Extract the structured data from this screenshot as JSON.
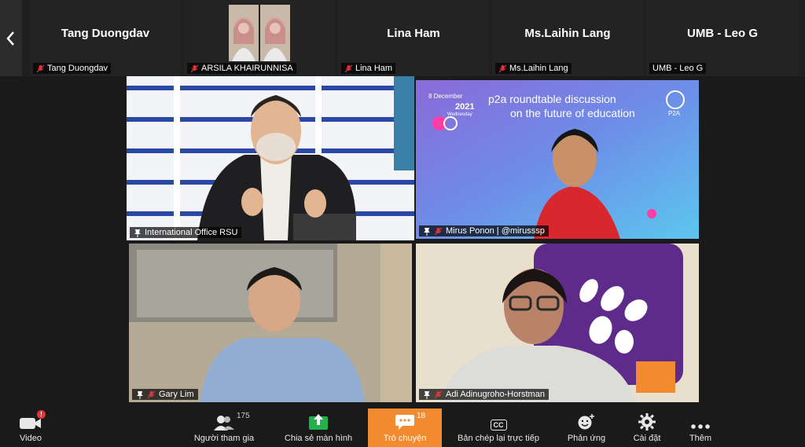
{
  "strip": {
    "tiles": [
      {
        "big_name": "Tang Duongdav",
        "label": "Tang Duongdav",
        "muted": true
      },
      {
        "big_name": "",
        "label": "ARSILA KHAIRUNNISA",
        "muted": true
      },
      {
        "big_name": "Lina Ham",
        "label": "Lina Ham",
        "muted": true
      },
      {
        "big_name": "Ms.Laihin Lang",
        "label": "Ms.Laihin Lang",
        "muted": true
      },
      {
        "big_name": "UMB - Leo G",
        "label": "UMB - Leo G",
        "muted": false
      }
    ]
  },
  "gallery": {
    "tiles": [
      {
        "label": "International Office RSU",
        "active": true
      },
      {
        "label": "Mirus Ponon | @mirusssp",
        "active": false
      },
      {
        "label": "Gary Lim",
        "active": false
      },
      {
        "label": "Adi Adinugroho-Horstman",
        "active": false
      }
    ],
    "banner": {
      "date": "8 December",
      "year": "2021",
      "weekday": "Wednesday",
      "line1": "p2a roundtable discussion",
      "line2": "on the future of education",
      "logo": "P2A"
    }
  },
  "toolbar": {
    "video": "Video",
    "video_badge": "!",
    "participants": "Người tham gia",
    "participants_count": "175",
    "share": "Chia sẻ màn hình",
    "chat": "Trò chuyện",
    "chat_count": "18",
    "cc": "Bản chép lại trực tiếp",
    "cc_icon_text": "CC",
    "react": "Phản ứng",
    "settings": "Cài đặt",
    "more": "Thêm"
  },
  "colors": {
    "active_border": "#c3d78a",
    "chat_bg": "#f28a30",
    "share_green": "#22b14c",
    "mute_red": "#e0363b"
  }
}
